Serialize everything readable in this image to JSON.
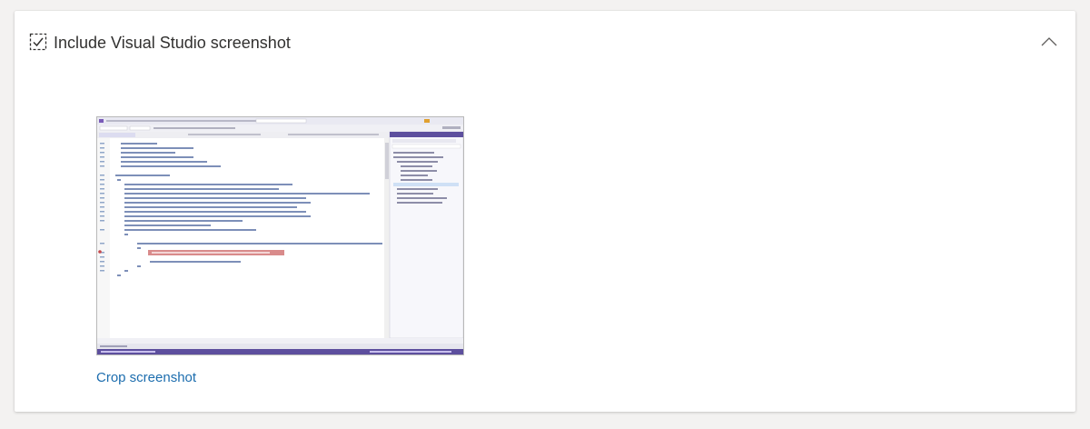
{
  "section": {
    "title": "Include Visual Studio screenshot",
    "checkbox_icon": "dashed-checkbox-check-icon",
    "collapse_icon": "chevron-up-icon"
  },
  "screenshot": {
    "thumbnail_icon": "visual-studio-screenshot-thumbnail",
    "colors": {
      "titlebar": "#e9e9f2",
      "statusbar": "#5d4f9e",
      "breakpoint": "#c5484b",
      "highlight": "#d98b8b"
    }
  },
  "actions": {
    "crop_label": "Crop screenshot"
  },
  "colors": {
    "accent": "#1c6dae",
    "text": "#323130",
    "background": "#f3f2f1"
  }
}
